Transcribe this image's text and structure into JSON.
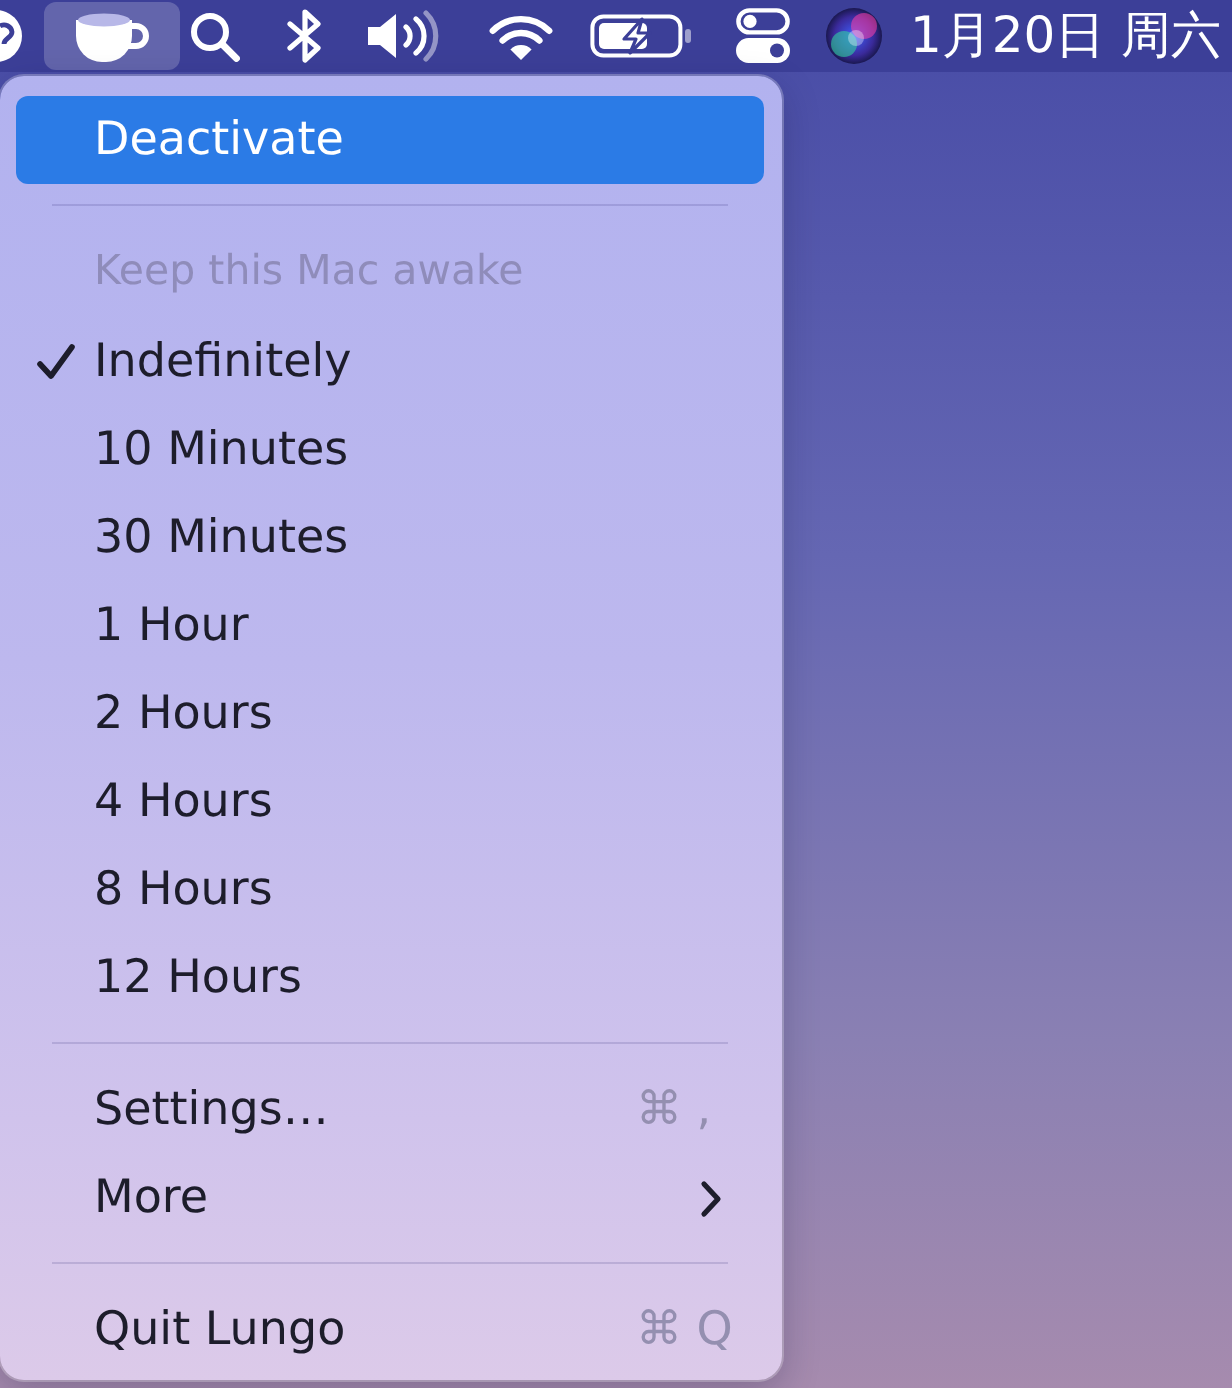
{
  "menu_bar": {
    "status_items": [
      {
        "kind": "round",
        "selected": false
      },
      {
        "kind": "cup",
        "selected": true
      },
      {
        "kind": "search",
        "selected": false
      },
      {
        "kind": "bluetooth",
        "selected": false
      },
      {
        "kind": "volume",
        "selected": false
      },
      {
        "kind": "wifi",
        "selected": false
      },
      {
        "kind": "battery",
        "selected": false
      },
      {
        "kind": "toggles",
        "selected": false
      },
      {
        "kind": "orb",
        "selected": false
      }
    ],
    "clock": "1月20日 周六"
  },
  "menu": {
    "items": [
      {
        "kind": "action",
        "label": "Deactivate",
        "selected": true
      },
      {
        "kind": "separator"
      },
      {
        "kind": "header",
        "label": "Keep this Mac awake"
      },
      {
        "kind": "option",
        "label": "Indefinitely",
        "checked": true,
        "selected": false
      },
      {
        "kind": "option",
        "label": "10 Minutes",
        "checked": false,
        "selected": false
      },
      {
        "kind": "option",
        "label": "30 Minutes",
        "checked": false,
        "selected": false
      },
      {
        "kind": "option",
        "label": "1 Hour",
        "checked": false,
        "selected": false
      },
      {
        "kind": "option",
        "label": "2 Hours",
        "checked": false,
        "selected": false
      },
      {
        "kind": "option",
        "label": "4 Hours",
        "checked": false,
        "selected": false
      },
      {
        "kind": "option",
        "label": "8 Hours",
        "checked": false,
        "selected": false
      },
      {
        "kind": "option",
        "label": "12 Hours",
        "checked": false,
        "selected": false
      },
      {
        "kind": "separator"
      },
      {
        "kind": "action",
        "label": "Settings…",
        "shortcut": "⌘ ,",
        "selected": false
      },
      {
        "kind": "submenu",
        "label": "More",
        "selected": false
      },
      {
        "kind": "separator"
      },
      {
        "kind": "action",
        "label": "Quit Lungo",
        "shortcut": "⌘ Q",
        "selected": false
      }
    ]
  }
}
